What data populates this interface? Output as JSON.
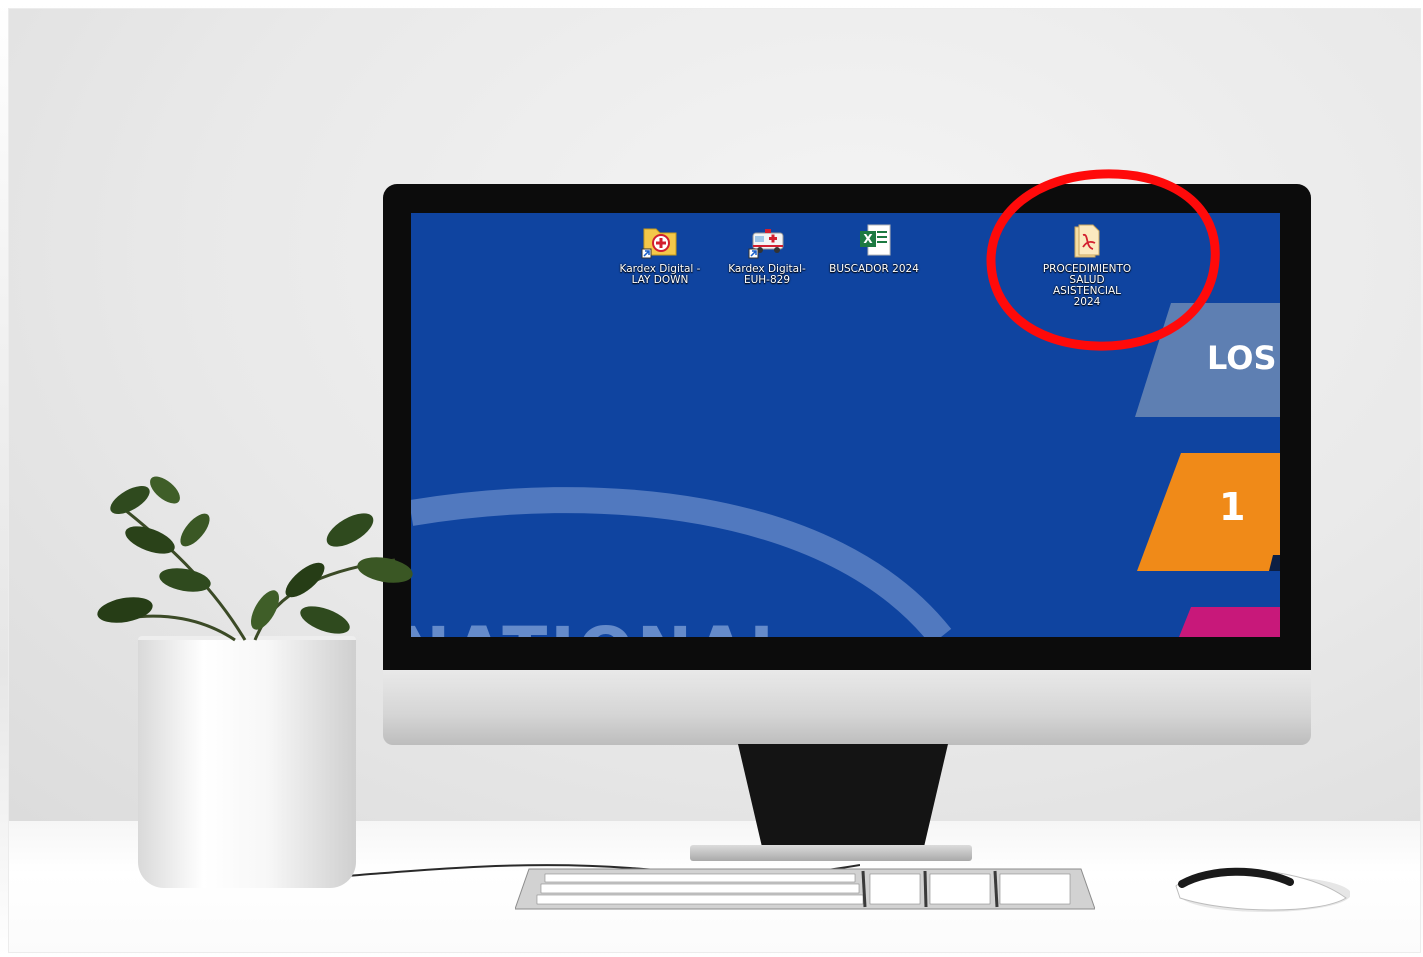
{
  "desktop": {
    "icons": [
      {
        "label": "Kardex Digital - LAY DOWN",
        "icon": "medical-folder-shortcut-icon"
      },
      {
        "label": "Kardex Digital-EUH-829",
        "icon": "ambulance-shortcut-icon"
      },
      {
        "label": "BUSCADOR 2024",
        "icon": "excel-file-icon"
      },
      {
        "label": "PROCEDIMIENTO SALUD ASISTENCIAL 2024",
        "icon": "pdf-file-icon"
      }
    ],
    "wallpaper": {
      "tile_text": "LOS",
      "number": "1",
      "bottom_text": "NATIONAL"
    }
  },
  "annotation": {
    "shape": "circle",
    "color": "#ff0000",
    "target": "PROCEDIMIENTO SALUD ASISTENCIAL 2024"
  },
  "colors": {
    "wallpaper": "#0f44a0",
    "orange": "#f08a18",
    "magenta": "#c8187a",
    "slate": "#5e7fb2"
  }
}
